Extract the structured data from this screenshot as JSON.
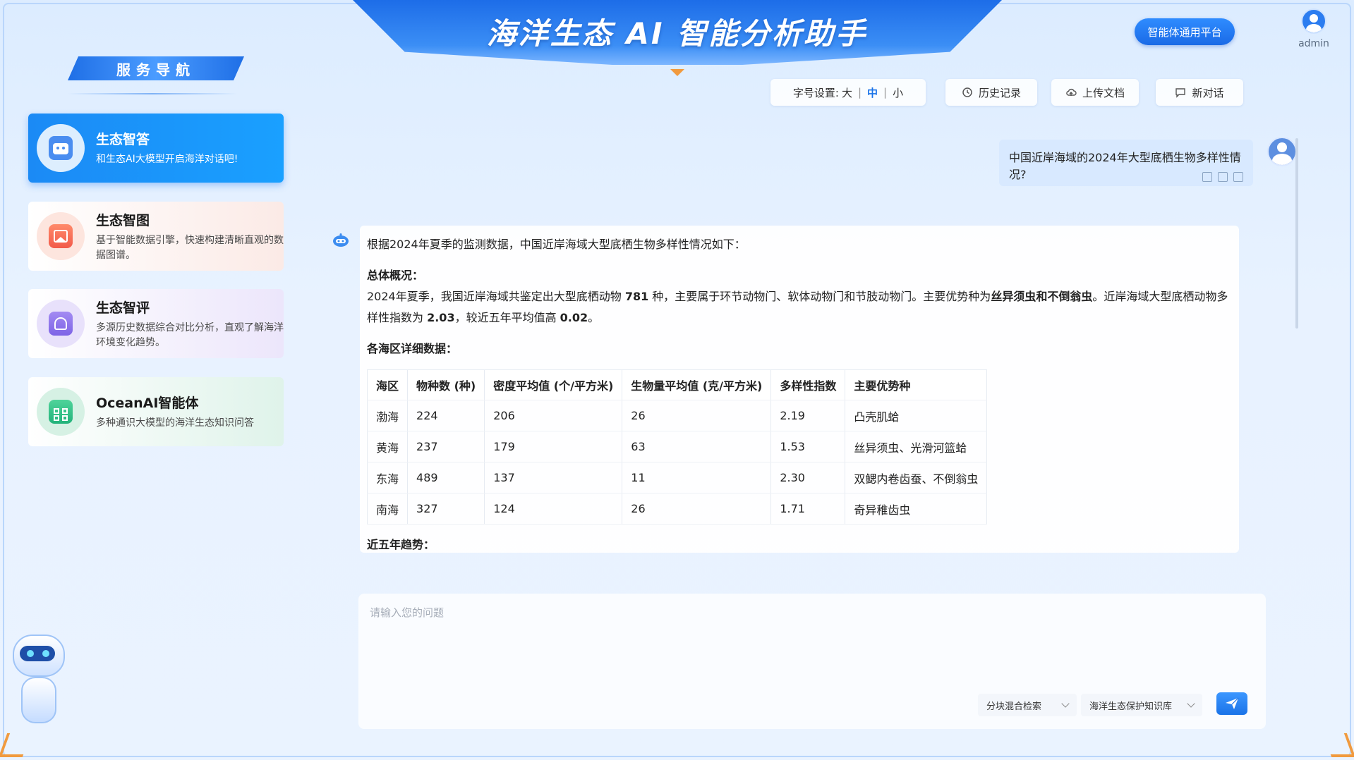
{
  "header": {
    "title": "海洋生态 AI 智能分析助手",
    "platform_button": "智能体通用平台",
    "user_name": "admin"
  },
  "sidebar": {
    "title": "服务导航",
    "items": [
      {
        "title": "生态智答",
        "desc": "和生态AI大模型开启海洋对话吧!",
        "icon": "robot-icon",
        "active": true
      },
      {
        "title": "生态智图",
        "desc": "基于智能数据引擎，快速构建清晰直观的数据图谱。",
        "icon": "image-icon"
      },
      {
        "title": "生态智评",
        "desc": "多源历史数据综合对比分析，直观了解海洋环境变化趋势。",
        "icon": "document-icon"
      },
      {
        "title": "OceanAI智能体",
        "desc": "多种通识大模型的海洋生态知识问答",
        "icon": "app-grid-icon"
      }
    ]
  },
  "toolbar": {
    "font_label": "字号设置:",
    "font_sizes": [
      "大",
      "中",
      "小"
    ],
    "font_selected": "中",
    "history": "历史记录",
    "upload": "上传文档",
    "new_chat": "新对话"
  },
  "chat": {
    "question": "中国近岸海域的2024年大型底栖生物多样性情况?",
    "answer": {
      "intro": "根据2024年夏季的监测数据，中国近岸海域大型底栖生物多样性情况如下：",
      "overview_title": "总体概况：",
      "overview": {
        "p1": "2024年夏季，我国近岸海域共鉴定出大型底栖动物 ",
        "species_total": "781",
        "p2": " 种，主要属于环节动物门、软体动物门和节肢动物门。主要优势种为",
        "dominant1": "丝异须虫",
        "and": "和",
        "dominant2": "不倒翁虫",
        "p3": "。近岸海域大型底栖动物多样性指数为 ",
        "diversity_index": "2.03",
        "p4": "，较近五年平均值高 ",
        "increase": "0.02",
        "p5": "。"
      },
      "detail_title": "各海区详细数据：",
      "table": {
        "headers": [
          "海区",
          "物种数 (种)",
          "密度平均值 (个/平方米)",
          "生物量平均值 (克/平方米)",
          "多样性指数",
          "主要优势种"
        ],
        "rows": [
          [
            "渤海",
            "224",
            "206",
            "26",
            "2.19",
            "凸壳肌蛤"
          ],
          [
            "黄海",
            "237",
            "179",
            "63",
            "1.53",
            "丝异须虫、光滑河篮蛤"
          ],
          [
            "东海",
            "489",
            "137",
            "11",
            "2.30",
            "双鳃内卷齿蚕、不倒翁虫"
          ],
          [
            "南海",
            "327",
            "124",
            "26",
            "1.71",
            "奇异稚齿虫"
          ]
        ]
      },
      "trend_title": "近五年趋势："
    }
  },
  "input": {
    "placeholder": "请输入您的问题",
    "retrieval_mode": "分块混合检索",
    "knowledge_base": "海洋生态保护知识库"
  },
  "colors": {
    "accent": "#1a73e8",
    "active_nav": "#1b8af5",
    "orange": "#f19a3e"
  }
}
